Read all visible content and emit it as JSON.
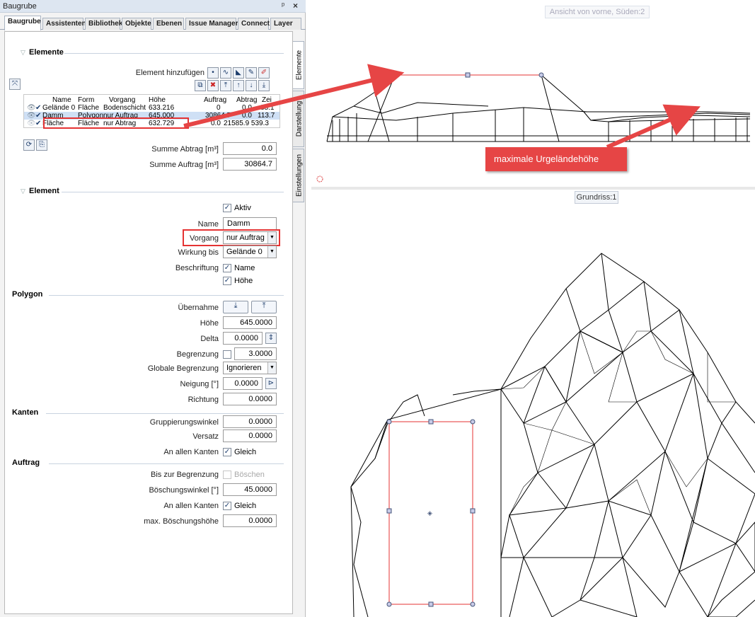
{
  "window": {
    "title": "Baugrube",
    "pin": "ᵖ",
    "close": "×"
  },
  "tabs": [
    "Baugrube",
    "Assistenten",
    "Bibliothek",
    "Objekte",
    "Ebenen",
    "Issue Manager",
    "Connect",
    "Layer"
  ],
  "side_tabs": [
    "Elemente",
    "Darstellung",
    "Einstellungen"
  ],
  "elemente": {
    "header": "Elemente",
    "add_label": "Element hinzufügen",
    "table": {
      "columns": [
        "Name",
        "Form",
        "Vorgang",
        "Höhe",
        "Auftrag",
        "Abtrag",
        "Zei"
      ],
      "rows": [
        {
          "name": "Gelände 0",
          "form": "Fläche",
          "vorgang": "Bodenschicht",
          "hoehe": "633.216",
          "auftrag": "0",
          "abtrag": "0.0",
          "zei": "88.1"
        },
        {
          "name": "Damm",
          "form": "Polygon",
          "vorgang": "nur Auftrag",
          "hoehe": "645.000",
          "auftrag": "30864.7",
          "abtrag": "0.0",
          "zei": "113.7"
        },
        {
          "name": "Fläche",
          "form": "Fläche",
          "vorgang": "nur Abtrag",
          "hoehe": "632.729",
          "auftrag": "",
          "abtrag": "0.0",
          "zei": "21585.9 539.3"
        }
      ]
    },
    "summe_abtrag_label": "Summe Abtrag [m³]",
    "summe_abtrag": "0.0",
    "summe_auftrag_label": "Summe Auftrag [m³]",
    "summe_auftrag": "30864.7"
  },
  "element": {
    "header": "Element",
    "aktiv": "Aktiv",
    "name_label": "Name",
    "name_value": "Damm",
    "vorgang_label": "Vorgang",
    "vorgang_value": "nur Auftrag",
    "wirkung_label": "Wirkung bis",
    "wirkung_value": "Gelände 0",
    "beschriftung_label": "Beschriftung",
    "beschriftung_name": "Name",
    "beschriftung_hoehe": "Höhe"
  },
  "polygon": {
    "header": "Polygon",
    "uebernahme_label": "Übernahme",
    "hoehe_label": "Höhe",
    "hoehe_value": "645.0000",
    "delta_label": "Delta",
    "delta_value": "0.0000",
    "begrenzung_label": "Begrenzung",
    "begrenzung_value": "3.0000",
    "globale_label": "Globale Begrenzung",
    "globale_value": "Ignorieren",
    "neigung_label": "Neigung [°]",
    "neigung_value": "0.0000",
    "richtung_label": "Richtung",
    "richtung_value": "0.0000"
  },
  "kanten": {
    "header": "Kanten",
    "gruppierung_label": "Gruppierungswinkel",
    "gruppierung_value": "0.0000",
    "versatz_label": "Versatz",
    "versatz_value": "0.0000",
    "an_allen_label": "An allen Kanten",
    "gleich": "Gleich"
  },
  "auftrag": {
    "header": "Auftrag",
    "bis_label": "Bis zur Begrenzung",
    "boeschen": "Böschen",
    "winkel_label": "Böschungswinkel [°]",
    "winkel_value": "45.0000",
    "an_allen_label": "An allen Kanten",
    "gleich": "Gleich",
    "max_label": "max. Böschungshöhe",
    "max_value": "0.0000"
  },
  "views": {
    "front_label": "Ansicht von vorne, Süden:2",
    "plan_label": "Grundriss:1",
    "callout": "maximale Urgeländehöhe"
  },
  "colors": {
    "accent_red": "#e64545",
    "selection": "#cfe0f5"
  }
}
